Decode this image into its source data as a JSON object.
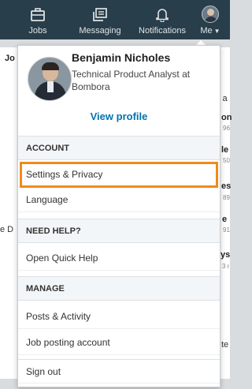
{
  "nav": {
    "items": [
      {
        "label": "Jobs",
        "icon": "briefcase-icon"
      },
      {
        "label": "Messaging",
        "icon": "messaging-icon"
      },
      {
        "label": "Notifications",
        "icon": "bell-icon"
      },
      {
        "label": "Me",
        "icon": "avatar"
      }
    ]
  },
  "background": {
    "fragments": [
      "Jo",
      "s a",
      "on",
      "96",
      "le",
      "50",
      "es",
      "89",
      "e",
      "e D",
      "91",
      "ys",
      "3 r",
      "te"
    ]
  },
  "profile": {
    "name": "Benjamin Nicholes",
    "title": "Technical Product Analyst at Bombora",
    "view_profile": "View profile"
  },
  "menu": {
    "account_header": "ACCOUNT",
    "settings": "Settings & Privacy",
    "language": "Language",
    "help_header": "NEED HELP?",
    "quick_help": "Open Quick Help",
    "manage_header": "MANAGE",
    "posts": "Posts & Activity",
    "job_posting": "Job posting account",
    "sign_out": "Sign out"
  },
  "colors": {
    "nav_bg": "#283e4a",
    "link_blue": "#0073b1",
    "highlight_orange": "#f18a1a"
  }
}
